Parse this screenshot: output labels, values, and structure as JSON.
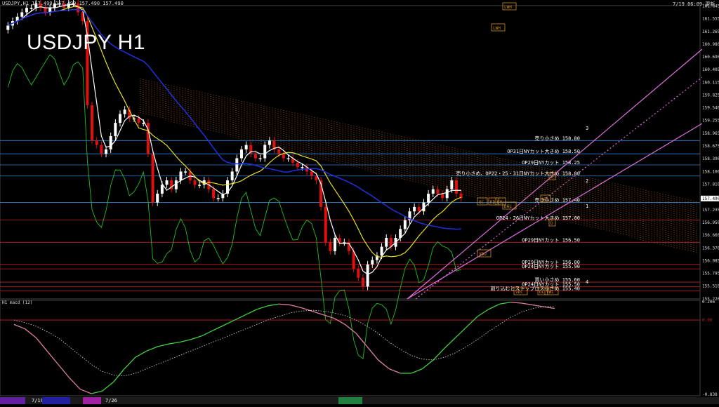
{
  "header": {
    "symbol_info": "USDJPY,H1  157.490 157.490 157.490 157.490",
    "datetime": "7/19 06:09 更新",
    "big_title": "USDJPY H1"
  },
  "colors": {
    "background": "#000000",
    "bull_candle": "#ffffff",
    "bear_candle": "#e01010",
    "sma_fast": "#ffffff",
    "sma_mid": "#e8e020",
    "sma_slow": "#2030e0",
    "bollinger": "#c01010",
    "lagging": "#20c020",
    "cloud": "#d07010",
    "channel": "#e070e0",
    "macd": "#40d040",
    "signal": "#e080a0"
  },
  "chart_data": [
    {
      "type": "candlestick",
      "title": "USDJPY H1",
      "price_axis_ticks": [
        "161.845",
        "161.555",
        "161.265",
        "160.980",
        "160.690",
        "160.405",
        "160.115",
        "159.825",
        "159.540",
        "159.255",
        "158.965",
        "158.675",
        "158.390",
        "158.100",
        "157.810",
        "157.490",
        "157.235",
        "156.950",
        "156.660",
        "156.370",
        "156.085",
        "155.795",
        "155.510",
        "155.220"
      ],
      "current_price": "157.490",
      "ylim": [
        155.22,
        161.85
      ],
      "grid": false,
      "candles_close": [
        161.4,
        161.5,
        161.6,
        161.7,
        161.8,
        161.8,
        161.9,
        161.8,
        161.7,
        161.8,
        161.9,
        161.9,
        161.8,
        161.9,
        161.9,
        161.7,
        161.5,
        159.6,
        158.8,
        158.7,
        158.5,
        158.6,
        158.9,
        159.2,
        159.4,
        159.5,
        159.3,
        159.3,
        159.2,
        159.2,
        158.5,
        157.4,
        157.6,
        157.8,
        157.9,
        157.7,
        157.9,
        158.1,
        158.1,
        157.9,
        157.8,
        157.8,
        157.9,
        157.7,
        157.5,
        157.5,
        157.6,
        157.9,
        158.1,
        158.4,
        158.6,
        158.7,
        158.5,
        158.4,
        158.4,
        158.7,
        158.8,
        158.6,
        158.5,
        158.4,
        158.4,
        158.3,
        158.2,
        158.2,
        158.1,
        158.0,
        157.9,
        157.3,
        156.5,
        156.3,
        156.6,
        156.5,
        156.5,
        156.3,
        155.9,
        155.7,
        155.5,
        156.0,
        156.1,
        156.2,
        156.4,
        156.6,
        156.4,
        156.6,
        156.8,
        157.0,
        157.2,
        157.3,
        157.2,
        157.4,
        157.6,
        157.7,
        157.6,
        157.5,
        157.7,
        157.9,
        157.6,
        157.5
      ],
      "candles_open": [
        161.3,
        161.4,
        161.5,
        161.6,
        161.7,
        161.8,
        161.8,
        161.9,
        161.8,
        161.7,
        161.8,
        161.9,
        161.9,
        161.8,
        161.9,
        161.9,
        161.7,
        161.5,
        159.6,
        158.8,
        158.7,
        158.5,
        158.6,
        158.9,
        159.2,
        159.4,
        159.5,
        159.3,
        159.3,
        159.2,
        159.2,
        158.5,
        157.4,
        157.6,
        157.8,
        157.9,
        157.7,
        157.9,
        158.1,
        158.1,
        157.9,
        157.8,
        157.8,
        157.9,
        157.7,
        157.5,
        157.5,
        157.6,
        157.9,
        158.1,
        158.4,
        158.6,
        158.7,
        158.5,
        158.4,
        158.4,
        158.7,
        158.8,
        158.6,
        158.5,
        158.4,
        158.4,
        158.3,
        158.2,
        158.2,
        158.1,
        158.0,
        157.9,
        157.3,
        156.5,
        156.3,
        156.6,
        156.5,
        156.5,
        156.3,
        155.9,
        155.7,
        155.5,
        156.0,
        156.1,
        156.2,
        156.4,
        156.6,
        156.4,
        156.6,
        156.8,
        157.0,
        157.2,
        157.3,
        157.2,
        157.4,
        157.6,
        157.7,
        157.6,
        157.5,
        157.7,
        157.9,
        157.6
      ],
      "horizontal_levels": [
        {
          "label": "売り小さめ 158.80",
          "price": 158.8,
          "color": "#3080d0"
        },
        {
          "label": "OP31日NYカット大きめ 158.50",
          "price": 158.5,
          "color": "#3080d0"
        },
        {
          "label": "OP29日NYカット 158.25",
          "price": 158.25,
          "color": "#3080d0"
        },
        {
          "label": "売り小さめ、OP22・25・31日NYカット大きめ 158.00",
          "price": 158.0,
          "color": "#3080d0"
        },
        {
          "label": "売り小さめ 157.40",
          "price": 157.4,
          "color": "#3080d0"
        },
        {
          "label": "OP24・26日NYカット大きめ 157.00",
          "price": 157.0,
          "color": "#c02020"
        },
        {
          "label": "OP29日NYカット 156.50",
          "price": 156.5,
          "color": "#c02020"
        },
        {
          "label": "OP29日NYカット 156.00",
          "price": 156.0,
          "color": "#c02020"
        },
        {
          "label": "OP24日NYカット 155.90",
          "price": 155.9,
          "color": "#c02020"
        },
        {
          "label": "買い小さめ 155.60",
          "price": 155.6,
          "color": "#c02020"
        },
        {
          "label": "OP24日NYカット 155.50",
          "price": 155.5,
          "color": "#c02020"
        },
        {
          "label": "割り込むとストップロス小さめ 155.40",
          "price": 155.4,
          "color": "#c02020"
        }
      ],
      "box_labels": [
        "LWH",
        "LWH",
        "OC",
        "KD",
        "DH",
        "DAL",
        "VDO",
        "VDC",
        "DL",
        "VWL",
        "D",
        "D",
        "HE"
      ],
      "channel_numbers": [
        "3",
        "2",
        "1",
        "4"
      ]
    },
    {
      "type": "line",
      "title": "H1 macd (12)",
      "ticks": [
        "0.206",
        "0.00",
        "-0.838"
      ],
      "series": [
        {
          "name": "",
          "values": [
            -0.05,
            -0.1,
            -0.2,
            -0.35,
            -0.5,
            -0.65,
            -0.78,
            -0.83,
            -0.8,
            -0.7,
            -0.55,
            -0.42,
            -0.35,
            -0.3,
            -0.27,
            -0.25,
            -0.22,
            -0.18,
            -0.12,
            -0.06,
            0.0,
            0.06,
            0.12,
            0.16,
            0.18,
            0.17,
            0.14,
            0.1,
            0.06,
            0.02,
            -0.05,
            -0.15,
            -0.3,
            -0.45,
            -0.55,
            -0.6,
            -0.6,
            -0.55,
            -0.45,
            -0.32,
            -0.2,
            -0.08,
            0.04,
            0.12,
            0.18,
            0.2,
            0.19,
            0.17,
            0.15,
            0.13
          ]
        },
        {
          "name": "",
          "values": [
            0.0,
            -0.03,
            -0.07,
            -0.13,
            -0.2,
            -0.3,
            -0.4,
            -0.5,
            -0.58,
            -0.62,
            -0.63,
            -0.6,
            -0.55,
            -0.5,
            -0.45,
            -0.4,
            -0.35,
            -0.3,
            -0.25,
            -0.2,
            -0.15,
            -0.1,
            -0.05,
            0.0,
            0.04,
            0.08,
            0.1,
            0.11,
            0.1,
            0.08,
            0.05,
            0.0,
            -0.07,
            -0.15,
            -0.25,
            -0.33,
            -0.4,
            -0.44,
            -0.45,
            -0.42,
            -0.37,
            -0.3,
            -0.22,
            -0.13,
            -0.05,
            0.03,
            0.09,
            0.13,
            0.15,
            0.15
          ]
        }
      ]
    }
  ],
  "bottom_bar": {
    "date_labels": [
      "7/19",
      "7/26"
    ]
  }
}
